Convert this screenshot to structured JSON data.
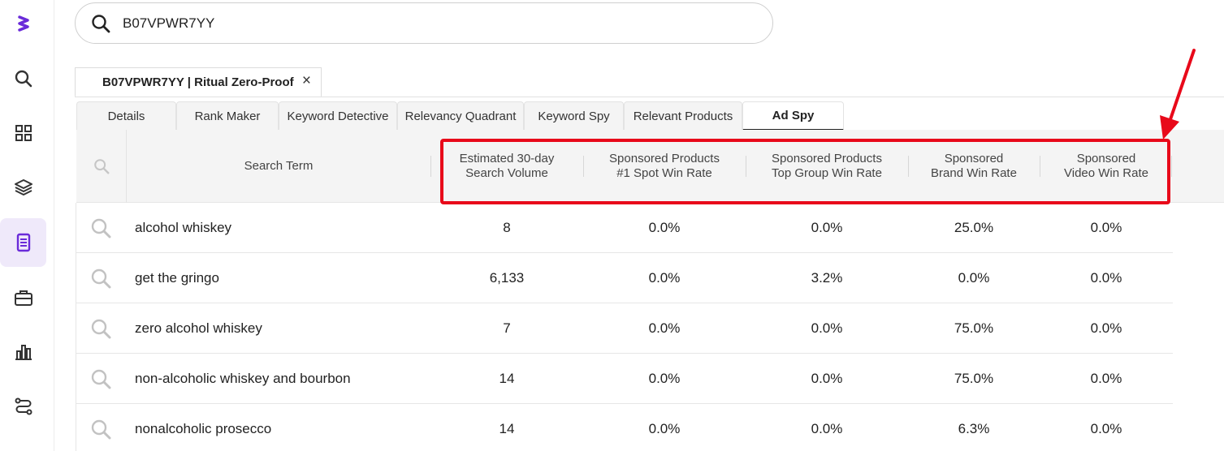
{
  "search": {
    "value": "B07VPWR7YY"
  },
  "product_tab": {
    "label": "B07VPWR7YY | Ritual Zero-Proof",
    "close": "×"
  },
  "subtabs": [
    "Details",
    "Rank Maker",
    "Keyword Detective",
    "Relevancy Quadrant",
    "Keyword Spy",
    "Relevant Products",
    "Ad Spy"
  ],
  "active_subtab": "Ad Spy",
  "columns": {
    "search_term": "Search Term",
    "volume": [
      "Estimated 30-day",
      "Search Volume"
    ],
    "sp_top": [
      "Sponsored Products",
      "#1 Spot Win Rate"
    ],
    "sp_group": [
      "Sponsored Products",
      "Top Group Win Rate"
    ],
    "brand": [
      "Sponsored",
      "Brand Win Rate"
    ],
    "video": [
      "Sponsored",
      "Video Win Rate"
    ]
  },
  "rows": [
    {
      "term": "alcohol whiskey",
      "volume": "8",
      "sp_top": "0.0%",
      "sp_group": "0.0%",
      "brand": "25.0%",
      "video": "0.0%"
    },
    {
      "term": "get the gringo",
      "volume": "6,133",
      "sp_top": "0.0%",
      "sp_group": "3.2%",
      "brand": "0.0%",
      "video": "0.0%"
    },
    {
      "term": "zero alcohol whiskey",
      "volume": "7",
      "sp_top": "0.0%",
      "sp_group": "0.0%",
      "brand": "75.0%",
      "video": "0.0%"
    },
    {
      "term": "non-alcoholic whiskey and bourbon",
      "volume": "14",
      "sp_top": "0.0%",
      "sp_group": "0.0%",
      "brand": "75.0%",
      "video": "0.0%"
    },
    {
      "term": "nonalcoholic prosecco",
      "volume": "14",
      "sp_top": "0.0%",
      "sp_group": "0.0%",
      "brand": "6.3%",
      "video": "0.0%"
    }
  ],
  "sidebar": {
    "icons": [
      "logo-icon",
      "search-icon",
      "grid-icon",
      "layers-icon",
      "document-icon",
      "briefcase-icon",
      "bar-chart-icon",
      "route-icon"
    ]
  },
  "colors": {
    "accent": "#6a2bd9",
    "highlight": "#e8091a",
    "active_bg": "#efe9fa"
  }
}
